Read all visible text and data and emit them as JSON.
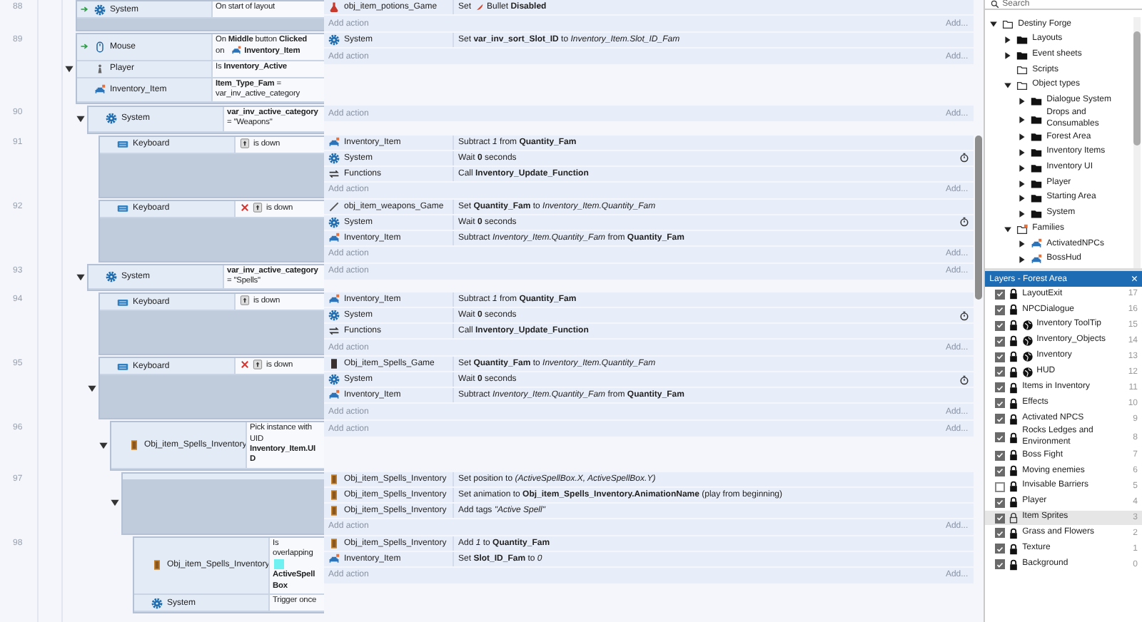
{
  "event_sheet": {
    "events": [
      {
        "number": "88",
        "conditions": [
          {
            "object": "System",
            "kind": "system",
            "trigger": true,
            "inverted": false,
            "parts": [
              {
                "kind": "text",
                "text": "On start of layout"
              }
            ]
          }
        ],
        "actions": [
          {
            "object": "obj_item_potions_Game",
            "kind": "potion",
            "timer": false,
            "parts": [
              {
                "kind": "text",
                "text": "Set"
              },
              {
                "kind": "bullet"
              },
              {
                "kind": "text",
                "text": "Bullet **Disabled**"
              }
            ]
          }
        ],
        "add_action": "Add action",
        "add_more": "Add..."
      },
      {
        "number": "89",
        "expanded": true,
        "conditions": [
          {
            "object": "Mouse",
            "kind": "mouse",
            "trigger": true,
            "inverted": false,
            "parts": [
              {
                "kind": "text",
                "text": "On **Middle** button **Clicked**"
              },
              {
                "kind": "text",
                "text": "on"
              },
              {
                "kind": "sprite"
              },
              {
                "kind": "text",
                "text": "**Inventory_Item**"
              }
            ]
          },
          {
            "object": "Player",
            "kind": "player",
            "trigger": false,
            "inverted": false,
            "parts": [
              {
                "kind": "text",
                "text": "Is **Inventory_Active**"
              }
            ]
          },
          {
            "object": "Inventory_Item",
            "kind": "sprite",
            "trigger": false,
            "inverted": false,
            "parts": [
              {
                "kind": "text",
                "text": "**Item_Type_Fam** = var_inv_active_category"
              }
            ]
          }
        ],
        "actions": [
          {
            "object": "System",
            "kind": "system",
            "timer": false,
            "parts": [
              {
                "kind": "text",
                "text": "Set **var_inv_sort_Slot_ID** to *Inventory_Item.Slot_ID_Fam*"
              }
            ]
          }
        ],
        "add_action": "Add action",
        "add_more": "Add...",
        "children": [
          {
            "number": "90",
            "expanded": true,
            "conditions": [
              {
                "object": "System",
                "kind": "system",
                "trigger": false,
                "inverted": false,
                "parts": [
                  {
                    "kind": "text",
                    "text": "**var_inv_active_category** = \"Weapons\""
                  }
                ]
              }
            ],
            "add_action": "Add action",
            "add_more": "Add...",
            "children": [
              {
                "number": "91",
                "conditions": [
                  {
                    "object": "Keyboard",
                    "kind": "keyboard",
                    "trigger": false,
                    "inverted": false,
                    "parts": [
                      {
                        "kind": "key"
                      },
                      {
                        "kind": "text",
                        "text": "is down"
                      }
                    ]
                  }
                ],
                "actions": [
                  {
                    "object": "Inventory_Item",
                    "kind": "sprite",
                    "timer": false,
                    "parts": [
                      {
                        "kind": "text",
                        "text": "Subtract *1* from **Quantity_Fam**"
                      }
                    ]
                  },
                  {
                    "object": "System",
                    "kind": "system",
                    "timer": true,
                    "parts": [
                      {
                        "kind": "text",
                        "text": "Wait **0** seconds"
                      }
                    ]
                  },
                  {
                    "object": "Functions",
                    "kind": "functions",
                    "timer": false,
                    "parts": [
                      {
                        "kind": "text",
                        "text": "Call **Inventory_Update_Function**"
                      }
                    ]
                  }
                ],
                "add_action": "Add action",
                "add_more": "Add..."
              },
              {
                "number": "92",
                "conditions": [
                  {
                    "object": "Keyboard",
                    "kind": "keyboard",
                    "trigger": false,
                    "inverted": true,
                    "parts": [
                      {
                        "kind": "key"
                      },
                      {
                        "kind": "text",
                        "text": "is down"
                      }
                    ]
                  }
                ],
                "actions": [
                  {
                    "object": "obj_item_weapons_Game",
                    "kind": "weapon",
                    "timer": false,
                    "parts": [
                      {
                        "kind": "text",
                        "text": "Set **Quantity_Fam** to *Inventory_Item.Quantity_Fam*"
                      }
                    ]
                  },
                  {
                    "object": "System",
                    "kind": "system",
                    "timer": true,
                    "parts": [
                      {
                        "kind": "text",
                        "text": "Wait **0** seconds"
                      }
                    ]
                  },
                  {
                    "object": "Inventory_Item",
                    "kind": "sprite",
                    "timer": false,
                    "parts": [
                      {
                        "kind": "text",
                        "text": "Subtract *Inventory_Item.Quantity_Fam* from **Quantity_Fam**"
                      }
                    ]
                  }
                ],
                "add_action": "Add action",
                "add_more": "Add..."
              }
            ]
          },
          {
            "number": "93",
            "expanded": true,
            "conditions": [
              {
                "object": "System",
                "kind": "system",
                "trigger": false,
                "inverted": false,
                "parts": [
                  {
                    "kind": "text",
                    "text": "**var_inv_active_category** = \"Spells\""
                  }
                ]
              }
            ],
            "add_action": "Add action",
            "add_more": "Add...",
            "children": [
              {
                "number": "94",
                "conditions": [
                  {
                    "object": "Keyboard",
                    "kind": "keyboard",
                    "trigger": false,
                    "inverted": false,
                    "parts": [
                      {
                        "kind": "key"
                      },
                      {
                        "kind": "text",
                        "text": "is down"
                      }
                    ]
                  }
                ],
                "actions": [
                  {
                    "object": "Inventory_Item",
                    "kind": "sprite",
                    "timer": false,
                    "parts": [
                      {
                        "kind": "text",
                        "text": "Subtract *1* from **Quantity_Fam**"
                      }
                    ]
                  },
                  {
                    "object": "System",
                    "kind": "system",
                    "timer": true,
                    "parts": [
                      {
                        "kind": "text",
                        "text": "Wait **0** seconds"
                      }
                    ]
                  },
                  {
                    "object": "Functions",
                    "kind": "functions",
                    "timer": false,
                    "parts": [
                      {
                        "kind": "text",
                        "text": "Call **Inventory_Update_Function**"
                      }
                    ]
                  }
                ],
                "add_action": "Add action",
                "add_more": "Add..."
              },
              {
                "number": "95",
                "expanded": true,
                "conditions": [
                  {
                    "object": "Keyboard",
                    "kind": "keyboard",
                    "trigger": false,
                    "inverted": true,
                    "parts": [
                      {
                        "kind": "key"
                      },
                      {
                        "kind": "text",
                        "text": "is down"
                      }
                    ]
                  }
                ],
                "actions": [
                  {
                    "object": "Obj_item_Spells_Game",
                    "kind": "spell_game",
                    "timer": false,
                    "parts": [
                      {
                        "kind": "text",
                        "text": "Set **Quantity_Fam** to *Inventory_Item.Quantity_Fam*"
                      }
                    ]
                  },
                  {
                    "object": "System",
                    "kind": "system",
                    "timer": true,
                    "parts": [
                      {
                        "kind": "text",
                        "text": "Wait **0** seconds"
                      }
                    ]
                  },
                  {
                    "object": "Inventory_Item",
                    "kind": "sprite",
                    "timer": false,
                    "parts": [
                      {
                        "kind": "text",
                        "text": "Subtract *Inventory_Item.Quantity_Fam* from **Quantity_Fam**"
                      }
                    ]
                  }
                ],
                "add_action": "Add action",
                "add_more": "Add...",
                "children": [
                  {
                    "number": "96",
                    "expanded": true,
                    "conditions": [
                      {
                        "object": "Obj_item_Spells_Inventory",
                        "kind": "spell_inv",
                        "trigger": false,
                        "inverted": false,
                        "parts": [
                          {
                            "kind": "text",
                            "text": "Pick instance with UID **Inventory_Item.UID**"
                          }
                        ]
                      }
                    ],
                    "add_action": "Add action",
                    "add_more": "Add...",
                    "children": [
                      {
                        "number": "97",
                        "expanded": true,
                        "actions": [
                          {
                            "object": "Obj_item_Spells_Inventory",
                            "kind": "spell_inv",
                            "timer": false,
                            "parts": [
                              {
                                "kind": "text",
                                "text": "Set position to *(ActiveSpellBox.X, ActiveSpellBox.Y)*"
                              }
                            ]
                          },
                          {
                            "object": "Obj_item_Spells_Inventory",
                            "kind": "spell_inv",
                            "timer": false,
                            "parts": [
                              {
                                "kind": "text",
                                "text": "Set animation to **Obj_item_Spells_Inventory.AnimationName** (play from beginning)"
                              }
                            ]
                          },
                          {
                            "object": "Obj_item_Spells_Inventory",
                            "kind": "spell_inv",
                            "timer": false,
                            "parts": [
                              {
                                "kind": "text",
                                "text": "Add tags *\"Active Spell\"*"
                              }
                            ]
                          }
                        ],
                        "add_action": "Add action",
                        "add_more": "Add...",
                        "children": [
                          {
                            "number": "98",
                            "conditions": [
                              {
                                "object": "Obj_item_Spells_Inventory",
                                "kind": "spell_inv",
                                "trigger": false,
                                "inverted": false,
                                "parts": [
                                  {
                                    "kind": "text",
                                    "text": "Is overlapping"
                                  },
                                  {
                                    "kind": "cyan_box"
                                  },
                                  {
                                    "kind": "text",
                                    "text": "**ActiveSpell Box**"
                                  }
                                ]
                              },
                              {
                                "object": "System",
                                "kind": "system",
                                "trigger": false,
                                "inverted": false,
                                "parts": [
                                  {
                                    "kind": "text",
                                    "text": "Trigger once"
                                  }
                                ]
                              }
                            ],
                            "actions": [
                              {
                                "object": "Obj_item_Spells_Inventory",
                                "kind": "spell_inv",
                                "timer": false,
                                "parts": [
                                  {
                                    "kind": "text",
                                    "text": "Add *1* to **Quantity_Fam**"
                                  }
                                ]
                              },
                              {
                                "object": "Inventory_Item",
                                "kind": "sprite",
                                "timer": false,
                                "parts": [
                                  {
                                    "kind": "text",
                                    "text": "Set **Slot_ID_Fam** to *0*"
                                  }
                                ]
                              }
                            ],
                            "add_action": "Add action",
                            "add_more": "Add..."
                          }
                        ]
                      }
                    ]
                  }
                ]
              }
            ]
          }
        ]
      }
    ]
  },
  "project": {
    "search": {
      "placeholder": "Search"
    },
    "tree": [
      {
        "label": "Destiny Forge",
        "kind": "folder_outline",
        "expanded": true,
        "children": [
          {
            "label": "Layouts",
            "kind": "folder",
            "expanded": false
          },
          {
            "label": "Event sheets",
            "kind": "folder",
            "expanded": false
          },
          {
            "label": "Scripts",
            "kind": "folder_outline"
          },
          {
            "label": "Object types",
            "kind": "folder_outline",
            "expanded": true,
            "children": [
              {
                "label": "Dialogue System",
                "kind": "folder",
                "expanded": false
              },
              {
                "label": "Drops and Consumables",
                "kind": "folder",
                "expanded": false
              },
              {
                "label": "Forest Area",
                "kind": "folder",
                "expanded": false
              },
              {
                "label": "Inventory Items",
                "kind": "folder",
                "expanded": false
              },
              {
                "label": "Inventory UI",
                "kind": "folder",
                "expanded": false
              },
              {
                "label": "Player",
                "kind": "folder",
                "expanded": false
              },
              {
                "label": "Starting Area",
                "kind": "folder",
                "expanded": false
              },
              {
                "label": "System",
                "kind": "folder",
                "expanded": false
              }
            ]
          },
          {
            "label": "Families",
            "kind": "family_folder",
            "expanded": true,
            "children": [
              {
                "label": "ActivatedNPCs",
                "kind": "family",
                "expanded": false
              },
              {
                "label": "BossHud",
                "kind": "family",
                "expanded": false
              }
            ]
          }
        ]
      }
    ]
  },
  "layers": {
    "title": "Layers - Forest Area",
    "close": "×",
    "items": [
      {
        "name": "LayoutExit",
        "number": "17",
        "visible": true,
        "locked": true,
        "global": false,
        "selected": false
      },
      {
        "name": "NPCDialogue",
        "number": "16",
        "visible": true,
        "locked": true,
        "global": false,
        "selected": false
      },
      {
        "name": "Inventory ToolTip",
        "number": "15",
        "visible": true,
        "locked": true,
        "global": true,
        "selected": false
      },
      {
        "name": "Inventory_Objects",
        "number": "14",
        "visible": true,
        "locked": true,
        "global": true,
        "selected": false
      },
      {
        "name": "Inventory",
        "number": "13",
        "visible": true,
        "locked": true,
        "global": true,
        "selected": false
      },
      {
        "name": "HUD",
        "number": "12",
        "visible": true,
        "locked": true,
        "global": true,
        "selected": false
      },
      {
        "name": "Items in Inventory",
        "number": "11",
        "visible": true,
        "locked": true,
        "global": false,
        "selected": false
      },
      {
        "name": "Effects",
        "number": "10",
        "visible": true,
        "locked": true,
        "global": false,
        "selected": false
      },
      {
        "name": "Activated NPCS",
        "number": "9",
        "visible": true,
        "locked": true,
        "global": false,
        "selected": false
      },
      {
        "name": "Rocks Ledges and Environment",
        "number": "8",
        "visible": true,
        "locked": true,
        "global": false,
        "selected": false
      },
      {
        "name": "Boss Fight",
        "number": "7",
        "visible": true,
        "locked": true,
        "global": false,
        "selected": false
      },
      {
        "name": "Moving enemies",
        "number": "6",
        "visible": true,
        "locked": true,
        "global": false,
        "selected": false
      },
      {
        "name": "Invisable Barriers",
        "number": "5",
        "visible": false,
        "locked": true,
        "global": false,
        "selected": false
      },
      {
        "name": "Player",
        "number": "4",
        "visible": true,
        "locked": true,
        "global": false,
        "selected": false
      },
      {
        "name": "Item Sprites",
        "number": "3",
        "visible": true,
        "locked": false,
        "global": false,
        "selected": true
      },
      {
        "name": "Grass and Flowers",
        "number": "2",
        "visible": true,
        "locked": true,
        "global": false,
        "selected": false
      },
      {
        "name": "Texture",
        "number": "1",
        "visible": true,
        "locked": true,
        "global": false,
        "selected": false
      },
      {
        "name": "Background",
        "number": "0",
        "visible": true,
        "locked": true,
        "global": false,
        "selected": false
      }
    ]
  }
}
